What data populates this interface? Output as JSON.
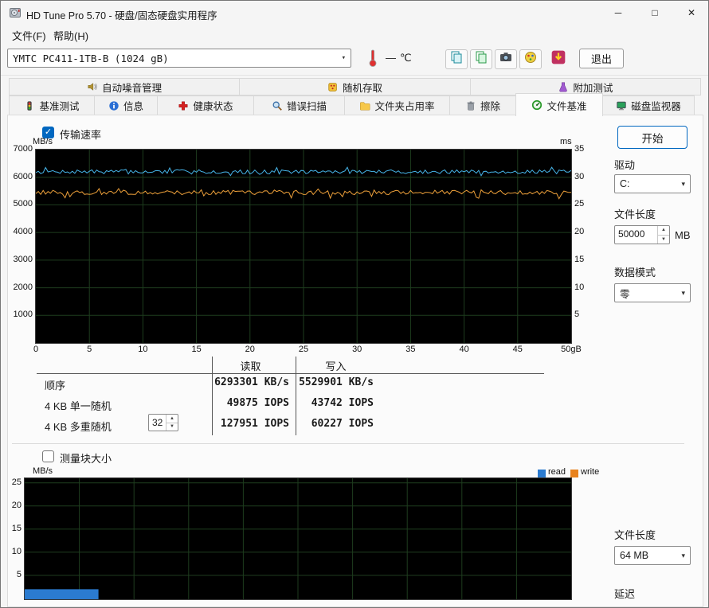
{
  "colors": {
    "accent": "#0067c0",
    "window_bg": "#f5f5f5",
    "page_bg": "#fbfbfb"
  },
  "window": {
    "title": "HD Tune Pro 5.70 - 硬盘/固态硬盘实用程序",
    "controls": {
      "minimize": "─",
      "maximize": "□",
      "close": "✕"
    }
  },
  "menu": {
    "items": [
      {
        "label": "文件(F)"
      },
      {
        "label": "帮助(H)"
      }
    ]
  },
  "toolbar": {
    "drive_select": "YMTC PC411-1TB-B (1024 gB)",
    "temperature": {
      "value": "—",
      "unit": "℃"
    },
    "exit_label": "退出"
  },
  "tabs": {
    "row1": [
      {
        "label": "自动噪音管理"
      },
      {
        "label": "随机存取"
      },
      {
        "label": "附加测试"
      }
    ],
    "row2": [
      {
        "label": "基准测试"
      },
      {
        "label": "信息"
      },
      {
        "label": "健康状态"
      },
      {
        "label": "错误扫描"
      },
      {
        "label": "文件夹占用率"
      },
      {
        "label": "擦除"
      },
      {
        "label": "文件基准",
        "active": true
      },
      {
        "label": "磁盘监视器"
      }
    ]
  },
  "benchmark": {
    "transfer_rate_label": "传输速率",
    "results": {
      "read_header": "读取",
      "write_header": "写入",
      "rows": [
        {
          "label": "顺序",
          "read": "6293301 KB/s",
          "write": "5529901 KB/s"
        },
        {
          "label": "4 KB 单一随机",
          "read": "49875 IOPS",
          "write": "43742 IOPS"
        },
        {
          "label": "4 KB 多重随机",
          "read": "127951 IOPS",
          "write": "60227 IOPS"
        }
      ],
      "queue_depth": "32"
    }
  },
  "block_size": {
    "label": "测量块大小"
  },
  "side_panel": {
    "start_label": "开始",
    "drive_label": "驱动",
    "drive_value": "C:",
    "file_length_label": "文件长度",
    "file_length_value": "50000",
    "file_length_unit": "MB",
    "data_pattern_label": "数据模式",
    "data_pattern_value": "零",
    "file_length2_label": "文件长度",
    "file_length2_value": "64 MB",
    "latency_label": "延迟"
  },
  "chart_data": [
    {
      "type": "line",
      "title": "传输速率 transfer rate over 50 GB file",
      "ylabel_left": "MB/s",
      "ylabel_right": "ms",
      "x_ticks": [
        "0",
        "5",
        "10",
        "15",
        "20",
        "25",
        "30",
        "35",
        "40",
        "45",
        "50gB"
      ],
      "y_left": {
        "max": 7000,
        "ticks": [
          7000,
          6000,
          5000,
          4000,
          3000,
          2000,
          1000
        ]
      },
      "y_right": {
        "max": 35,
        "ticks": [
          35,
          30,
          25,
          20,
          15,
          10,
          5
        ]
      },
      "grid_color": "#1e3d1e",
      "bg": "#000000",
      "series": [
        {
          "name": "read",
          "color": "#46b4e8",
          "mean_mbs": 6200,
          "noise": 70,
          "dip": 140,
          "spike": 160,
          "seed": 7
        },
        {
          "name": "write",
          "color": "#eda03a",
          "mean_mbs": 5450,
          "noise": 80,
          "dip": 260,
          "spike": 80,
          "seed": 13
        }
      ]
    },
    {
      "type": "bar",
      "ylabel": "MB/s",
      "y_max": 26,
      "y_ticks": [
        25,
        20,
        15,
        10,
        5
      ],
      "grid_color": "#1e3d1e",
      "bg": "#000000",
      "legend": [
        {
          "name": "read",
          "color": "#2b7bd0"
        },
        {
          "name": "write",
          "color": "#e8821e"
        }
      ],
      "bars": [
        {
          "series": "read",
          "x_frac": 0,
          "w_frac": 0.135,
          "value_mbs": 2
        }
      ]
    }
  ]
}
